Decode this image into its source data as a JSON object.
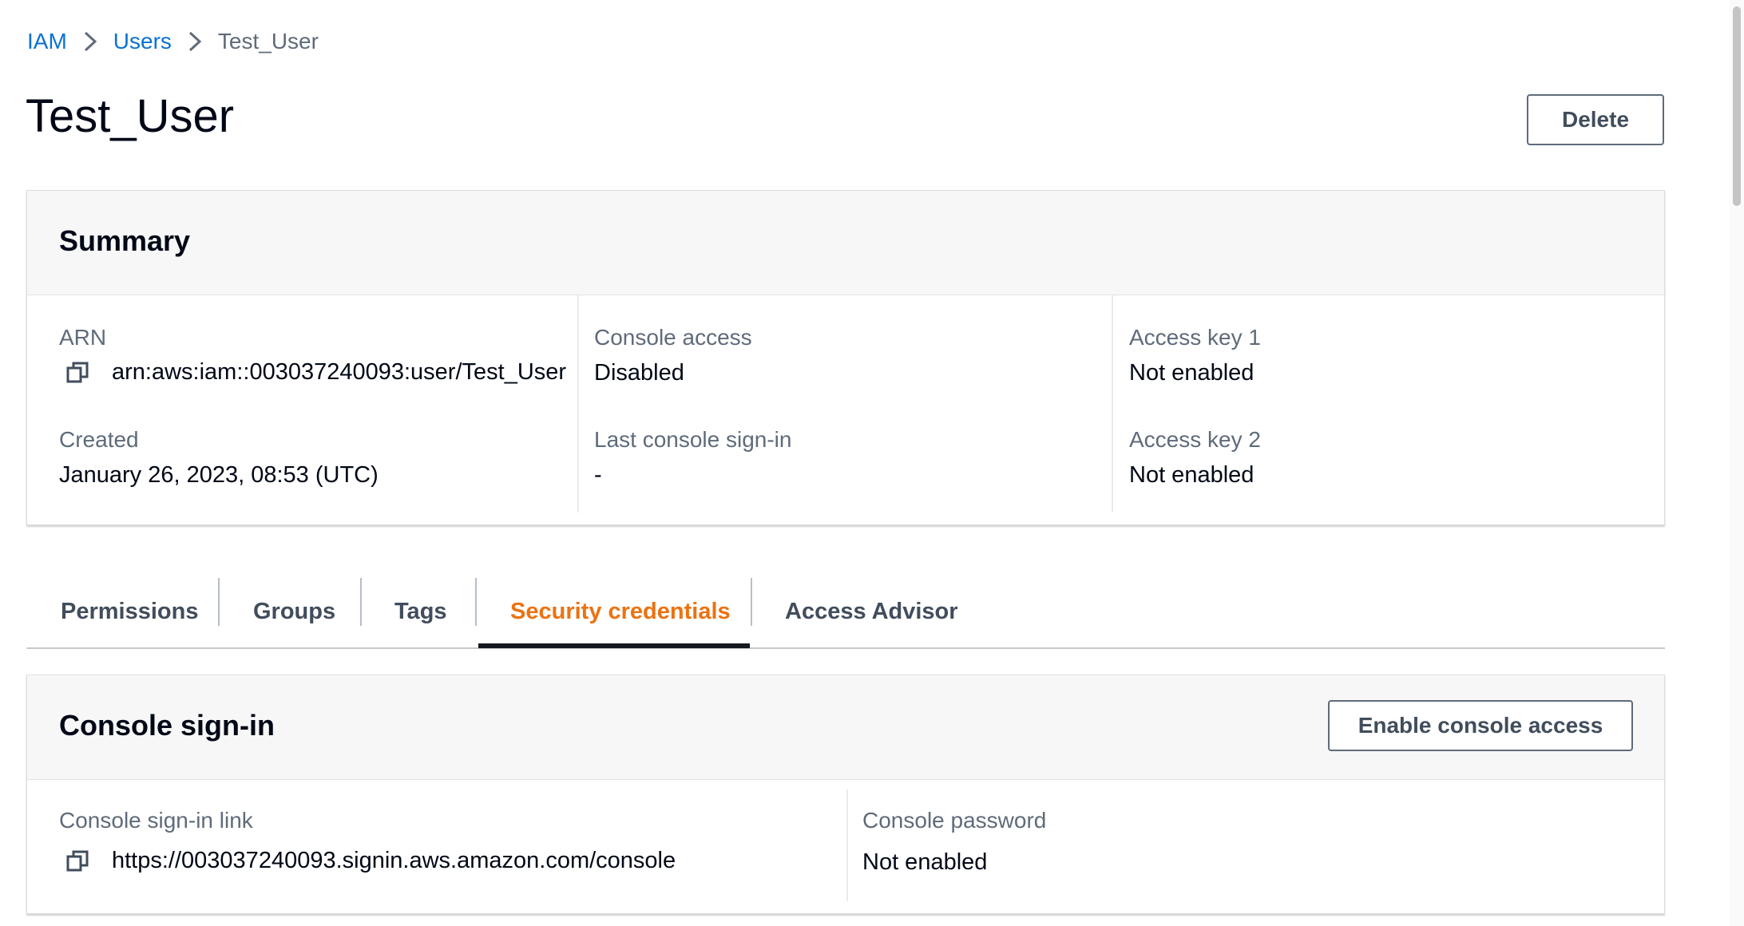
{
  "breadcrumb": {
    "items": [
      "IAM",
      "Users",
      "Test_User"
    ]
  },
  "header": {
    "title": "Test_User",
    "delete_label": "Delete"
  },
  "summary": {
    "title": "Summary",
    "arn_label": "ARN",
    "arn_value": "arn:aws:iam::003037240093:user/Test_User",
    "created_label": "Created",
    "created_value": "January 26, 2023, 08:53 (UTC)",
    "console_access_label": "Console access",
    "console_access_value": "Disabled",
    "last_signin_label": "Last console sign-in",
    "last_signin_value": "-",
    "access_key1_label": "Access key 1",
    "access_key1_value": "Not enabled",
    "access_key2_label": "Access key 2",
    "access_key2_value": "Not enabled"
  },
  "tabs": [
    {
      "label": "Permissions"
    },
    {
      "label": "Groups"
    },
    {
      "label": "Tags"
    },
    {
      "label": "Security credentials"
    },
    {
      "label": "Access Advisor"
    }
  ],
  "active_tab": "Security credentials",
  "console_signin": {
    "title": "Console sign-in",
    "enable_label": "Enable console access",
    "link_label": "Console sign-in link",
    "link_value": "https://003037240093.signin.aws.amazon.com/console",
    "password_label": "Console password",
    "password_value": "Not enabled"
  },
  "colors": {
    "link": "#0972d3",
    "active_tab": "#ec7211",
    "text": "#000716",
    "muted": "#5f6b7a"
  },
  "icons": {
    "breadcrumb_separator": "chevron-right-icon",
    "copy": "copy-icon"
  }
}
